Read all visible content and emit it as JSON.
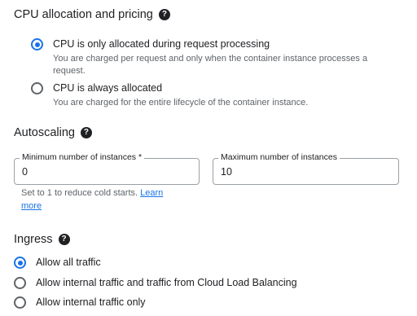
{
  "cpu": {
    "title": "CPU allocation and pricing",
    "options": [
      {
        "label": "CPU is only allocated during request processing",
        "description": "You are charged per request and only when the container instance processes a request.",
        "checked": true
      },
      {
        "label": "CPU is always allocated",
        "description": "You are charged for the entire lifecycle of the container instance.",
        "checked": false
      }
    ]
  },
  "autoscaling": {
    "title": "Autoscaling",
    "min_label": "Minimum number of instances *",
    "min_value": "0",
    "max_label": "Maximum number of instances",
    "max_value": "10",
    "hint_text": "Set to 1 to reduce cold starts.",
    "hint_link": "Learn more"
  },
  "ingress": {
    "title": "Ingress",
    "options": [
      {
        "label": "Allow all traffic",
        "checked": true
      },
      {
        "label": "Allow internal traffic and traffic from Cloud Load Balancing",
        "checked": false
      },
      {
        "label": "Allow internal traffic only",
        "checked": false
      }
    ]
  },
  "icons": {
    "help": "help-icon",
    "radio_checked": "radio-checked-icon",
    "radio_unchecked": "radio-unchecked-icon"
  },
  "colors": {
    "accent": "#1a73e8",
    "text": "#202124",
    "secondary": "#5f6368",
    "border": "#9aa0a6"
  }
}
